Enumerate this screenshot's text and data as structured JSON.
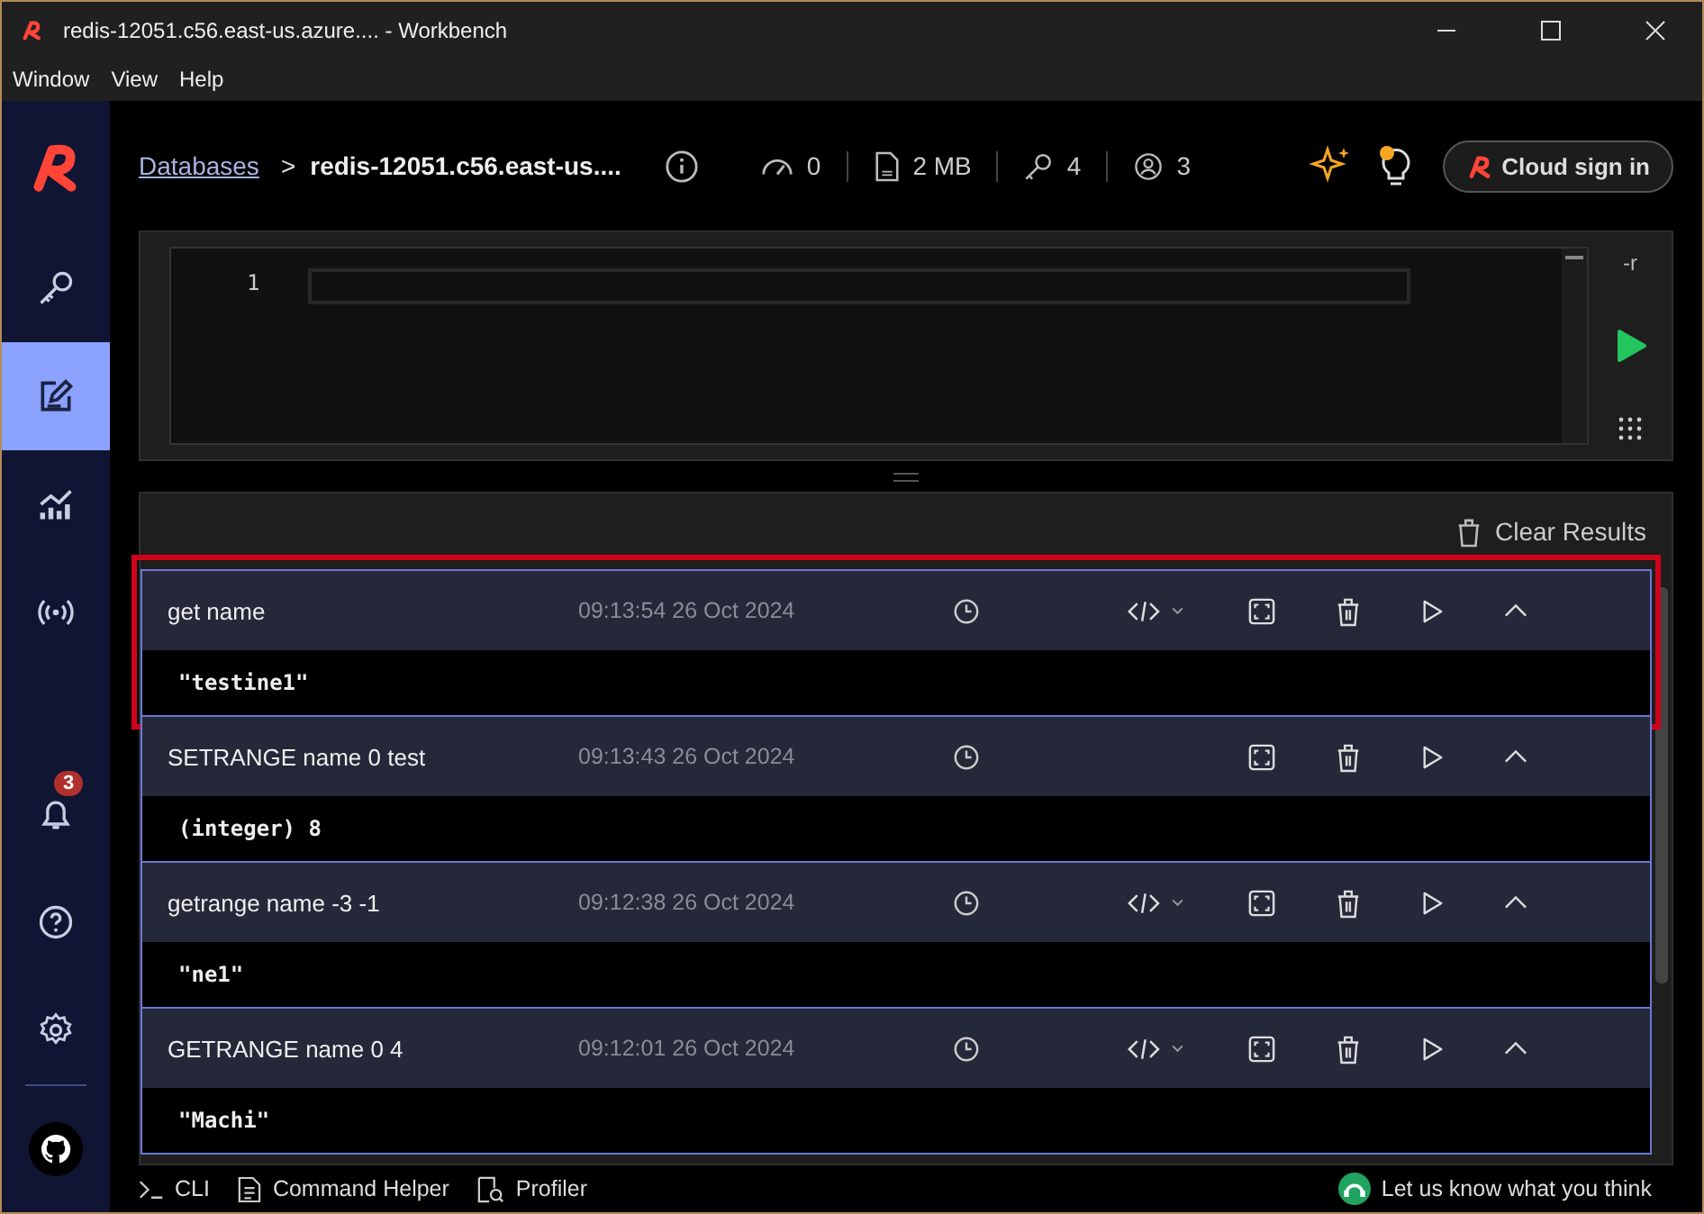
{
  "window": {
    "title": "redis-12051.c56.east-us.azure.... - Workbench"
  },
  "menu": [
    "Window",
    "View",
    "Help"
  ],
  "sidebar": {
    "nav": [
      {
        "selected": false
      },
      {
        "selected": true
      },
      {
        "selected": false
      },
      {
        "selected": false
      }
    ],
    "notifications_badge": "3"
  },
  "header": {
    "breadcrumb_link": "Databases",
    "separator": ">",
    "database": "redis-12051.c56.east-us....",
    "stats": [
      "0",
      "2 MB",
      "4",
      "3"
    ],
    "cloud_button": "Cloud sign in"
  },
  "editor": {
    "line_number": "1",
    "raw_flag": "-r"
  },
  "results": {
    "clear_button": "Clear Results",
    "items": [
      {
        "command": "get name",
        "time": "09:13:54 26 Oct 2024",
        "output": "\"testine1\"",
        "code_view": true,
        "highlighted": true
      },
      {
        "command": "SETRANGE name 0 test",
        "time": "09:13:43 26 Oct 2024",
        "output": "(integer) 8",
        "code_view": false,
        "highlighted": false
      },
      {
        "command": "getrange name -3 -1",
        "time": "09:12:38 26 Oct 2024",
        "output": "\"ne1\"",
        "code_view": true,
        "highlighted": false
      },
      {
        "command": "GETRANGE name 0 4",
        "time": "09:12:01 26 Oct 2024",
        "output": "\"Machi\"",
        "code_view": true,
        "highlighted": false
      }
    ]
  },
  "bottom_bar": {
    "tabs": [
      "CLI",
      "Command Helper",
      "Profiler"
    ],
    "feedback": "Let us know what you think"
  }
}
